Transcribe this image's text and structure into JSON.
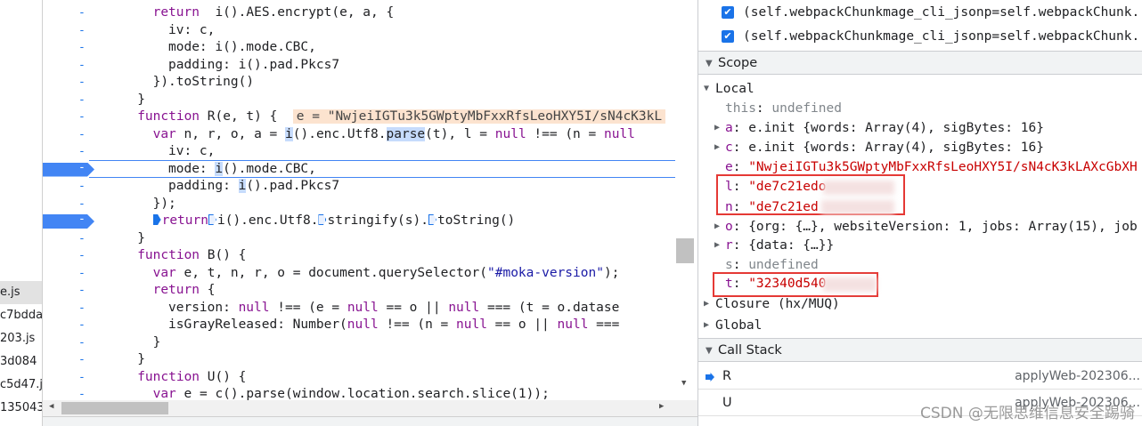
{
  "file_list": {
    "items": [
      "e.js",
      "c7bdda",
      "203.js",
      "3d084",
      "c5d47.j",
      "135043"
    ],
    "selected_index": 0
  },
  "editor": {
    "lines": [
      {
        "indent": 4,
        "tokens": [
          [
            "kw",
            "return"
          ],
          [
            "",
            "  i().AES.encrypt(e, a, {"
          ]
        ]
      },
      {
        "indent": 5,
        "tokens": [
          [
            "",
            "iv: c,"
          ]
        ]
      },
      {
        "indent": 5,
        "tokens": [
          [
            "",
            "mode: i().mode.CBC,"
          ]
        ]
      },
      {
        "indent": 5,
        "tokens": [
          [
            "",
            "padding: i().pad.Pkcs7"
          ]
        ]
      },
      {
        "indent": 4,
        "tokens": [
          [
            "",
            "}).toString()"
          ]
        ]
      },
      {
        "indent": 3,
        "tokens": [
          [
            "",
            "}"
          ]
        ]
      },
      {
        "indent": 3,
        "tokens": [
          [
            "kw",
            "function"
          ],
          [
            "",
            " R(e, t) {  "
          ],
          [
            "inline",
            "e = \"NwjeiIGTu3k5GWptyMbFxxRfsLeoHXY5I/sN4cK3kL"
          ]
        ]
      },
      {
        "indent": 4,
        "tokens": [
          [
            "kw",
            "var"
          ],
          [
            "",
            " n, r, o, a = "
          ],
          [
            "hl",
            "i"
          ],
          [
            "",
            "().enc.Utf8."
          ],
          [
            "hl",
            "parse"
          ],
          [
            "",
            "(t), l = "
          ],
          [
            "kw",
            "null"
          ],
          [
            "",
            " !== (n = "
          ],
          [
            "kw",
            "null"
          ]
        ]
      },
      {
        "indent": 5,
        "tokens": [
          [
            "",
            "iv: c,"
          ]
        ]
      },
      {
        "indent": 5,
        "tokens": [
          [
            "",
            "mode: "
          ],
          [
            "hl",
            "i"
          ],
          [
            "",
            "().mode.CBC,"
          ]
        ]
      },
      {
        "indent": 5,
        "tokens": [
          [
            "",
            "padding: "
          ],
          [
            "hl",
            "i"
          ],
          [
            "",
            "().pad.Pkcs7"
          ]
        ]
      },
      {
        "indent": 4,
        "tokens": [
          [
            "",
            "});"
          ]
        ]
      },
      {
        "indent": 4,
        "tokens": [
          [
            "step",
            "solid"
          ],
          [
            "kw",
            "return"
          ],
          [
            "step",
            ""
          ],
          [
            "",
            "i().enc.Utf8."
          ],
          [
            "step",
            ""
          ],
          [
            "",
            "stringify(s)."
          ],
          [
            "step",
            ""
          ],
          [
            "",
            "toString()"
          ]
        ]
      },
      {
        "indent": 3,
        "tokens": [
          [
            "",
            "}"
          ]
        ]
      },
      {
        "indent": 3,
        "tokens": [
          [
            "kw",
            "function"
          ],
          [
            "",
            " B() {"
          ]
        ]
      },
      {
        "indent": 4,
        "tokens": [
          [
            "kw",
            "var"
          ],
          [
            "",
            " e, t, n, r, o = document.querySelector("
          ],
          [
            "str",
            "\"#moka-version\""
          ],
          [
            "",
            ");"
          ]
        ]
      },
      {
        "indent": 4,
        "tokens": [
          [
            "kw",
            "return"
          ],
          [
            "",
            " {"
          ]
        ]
      },
      {
        "indent": 5,
        "tokens": [
          [
            "",
            "version: "
          ],
          [
            "kw",
            "null"
          ],
          [
            "",
            " !== (e = "
          ],
          [
            "kw",
            "null"
          ],
          [
            "",
            " == o || "
          ],
          [
            "kw",
            "null"
          ],
          [
            "",
            " === (t = o.datase"
          ]
        ]
      },
      {
        "indent": 5,
        "tokens": [
          [
            "",
            "isGrayReleased: Number("
          ],
          [
            "kw",
            "null"
          ],
          [
            "",
            " !== (n = "
          ],
          [
            "kw",
            "null"
          ],
          [
            "",
            " == o || "
          ],
          [
            "kw",
            "null"
          ],
          [
            "",
            " ==="
          ]
        ]
      },
      {
        "indent": 4,
        "tokens": [
          [
            "",
            "}"
          ]
        ]
      },
      {
        "indent": 3,
        "tokens": [
          [
            "",
            "}"
          ]
        ]
      },
      {
        "indent": 3,
        "tokens": [
          [
            "kw",
            "function"
          ],
          [
            "",
            " U() {"
          ]
        ]
      },
      {
        "indent": 4,
        "tokens": [
          [
            "kw",
            "var"
          ],
          [
            "",
            " e = c().parse(window.location.search.slice(1));"
          ]
        ]
      }
    ],
    "gutter_marker": "-",
    "breakpoint_lines": [
      9,
      12
    ]
  },
  "breakpoints": [
    {
      "text": "(self.webpackChunkmage_cli_jsonp=self.webpackChunk...",
      "checked": true
    },
    {
      "text": "(self.webpackChunkmage_cli_jsonp=self.webpackChunk...",
      "checked": true
    }
  ],
  "scope": {
    "title": "Scope",
    "local_title": "Local",
    "rows": [
      {
        "expandable": false,
        "name": "this",
        "sep": ": ",
        "value": "undefined",
        "kind": "undef"
      },
      {
        "expandable": true,
        "name": "a",
        "sep": ": ",
        "value": "e.init {words: Array(4), sigBytes: 16}",
        "kind": "obj"
      },
      {
        "expandable": true,
        "name": "c",
        "sep": ": ",
        "value": "e.init {words: Array(4), sigBytes: 16}",
        "kind": "obj"
      },
      {
        "expandable": false,
        "name": "e",
        "sep": ": ",
        "value": "\"NwjeiIGTu3k5GWptyMbFxxRfsLeoHXY5I/sN4cK3kLAXcGbXH",
        "kind": "str"
      },
      {
        "expandable": false,
        "name": "l",
        "sep": ": ",
        "value": "\"de7c21edo",
        "kind": "str"
      },
      {
        "expandable": false,
        "name": "n",
        "sep": ": ",
        "value": "\"de7c21ed",
        "kind": "str"
      },
      {
        "expandable": true,
        "name": "o",
        "sep": ": ",
        "value": "{org: {…}, websiteVersion: 1, jobs: Array(15), job",
        "kind": "obj"
      },
      {
        "expandable": true,
        "name": "r",
        "sep": ": ",
        "value": "{data: {…}}",
        "kind": "obj"
      },
      {
        "expandable": false,
        "name": "s",
        "sep": ": ",
        "value": "undefined",
        "kind": "undef"
      },
      {
        "expandable": false,
        "name": "t",
        "sep": ": ",
        "value": "\"32340d540",
        "kind": "str"
      }
    ],
    "closure_label": "Closure (hx/MUQ)",
    "global_label": "Global"
  },
  "call_stack": {
    "title": "Call Stack",
    "frames": [
      {
        "name": "R",
        "location": "applyWeb-202306...",
        "current": true
      },
      {
        "name": "U",
        "location": "applyWeb-202306...",
        "current": false
      }
    ]
  },
  "watermark": "CSDN @无限思维信息安全踢骑"
}
